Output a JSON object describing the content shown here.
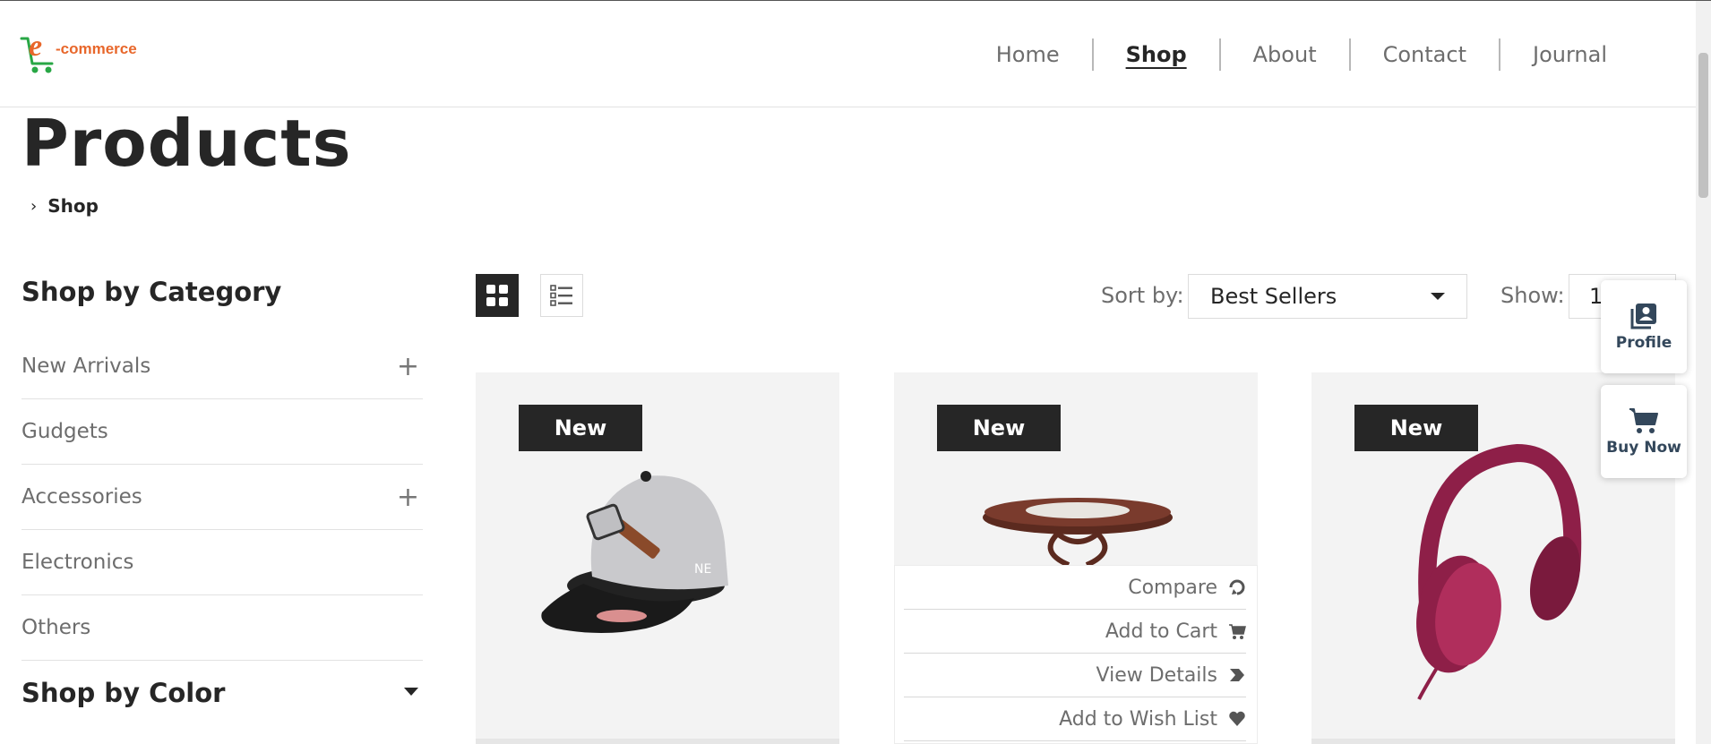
{
  "brand": {
    "logo_text": "-commerce",
    "logo_letter": "e"
  },
  "nav": {
    "items": [
      {
        "label": "Home"
      },
      {
        "label": "Shop"
      },
      {
        "label": "About"
      },
      {
        "label": "Contact"
      },
      {
        "label": "Journal"
      }
    ],
    "active": "Shop"
  },
  "page": {
    "title": "Products",
    "breadcrumb": "Shop"
  },
  "sidebar": {
    "category_heading": "Shop by Category",
    "categories": [
      {
        "label": "New Arrivals",
        "expandable": true
      },
      {
        "label": "Gudgets",
        "expandable": false
      },
      {
        "label": "Accessories",
        "expandable": true
      },
      {
        "label": "Electronics",
        "expandable": false
      },
      {
        "label": "Others",
        "expandable": false
      }
    ],
    "color_heading": "Shop by Color"
  },
  "toolbar": {
    "sort_label": "Sort by:",
    "sort_value": "Best Sellers",
    "show_label": "Show:",
    "show_value": "12"
  },
  "products": [
    {
      "badge": "New",
      "image": "cap"
    },
    {
      "badge": "New",
      "image": "round-table"
    },
    {
      "badge": "New",
      "image": "headphones"
    }
  ],
  "hover_actions": [
    {
      "label": "Compare",
      "icon": "compare-icon"
    },
    {
      "label": "Add to Cart",
      "icon": "cart-icon"
    },
    {
      "label": "View Details",
      "icon": "arrow-tag-icon"
    },
    {
      "label": "Add to Wish List",
      "icon": "heart-icon"
    }
  ],
  "floating": {
    "profile_label": "Profile",
    "buy_label": "Buy Now"
  },
  "colors": {
    "brand_orange": "#e8672b",
    "brand_green": "#28a745",
    "dark": "#262626",
    "muted_text": "#6d6d6d",
    "float_text": "#33475b"
  }
}
